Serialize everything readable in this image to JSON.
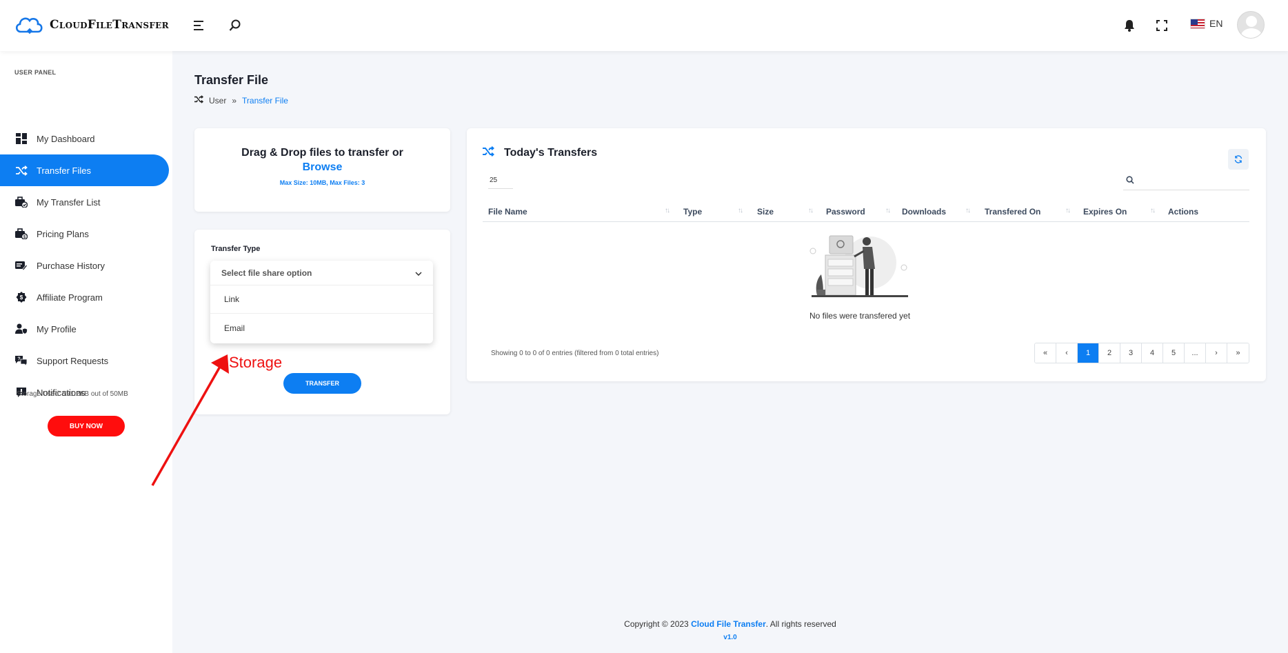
{
  "app": {
    "logo_text": "CloudFileTransfer"
  },
  "header": {
    "language": "EN"
  },
  "sidebar": {
    "panel_label": "USER PANEL",
    "items": [
      {
        "label": "My Dashboard",
        "icon": "dashboard-icon"
      },
      {
        "label": "Transfer Files",
        "icon": "shuffle-icon",
        "active": true
      },
      {
        "label": "My Transfer List",
        "icon": "briefcase-check-icon"
      },
      {
        "label": "Pricing Plans",
        "icon": "briefcase-tag-icon"
      },
      {
        "label": "Purchase History",
        "icon": "edit-card-icon"
      },
      {
        "label": "Affiliate Program",
        "icon": "dollar-badge-icon"
      },
      {
        "label": "My Profile",
        "icon": "user-shield-icon"
      },
      {
        "label": "Support Requests",
        "icon": "question-chat-icon"
      },
      {
        "label": "Notifications",
        "icon": "alert-badge-icon"
      }
    ],
    "storage_used": "Storage Used: 591.2KB out of 50MB",
    "buy_now": "BUY NOW"
  },
  "page": {
    "title": "Transfer File",
    "breadcrumb": {
      "parent": "User",
      "separator": "»",
      "current": "Transfer File"
    }
  },
  "dropzone": {
    "title": "Drag & Drop files to transfer or",
    "browse": "Browse",
    "limits": "Max Size: 10MB, Max Files: 3"
  },
  "transfer_type": {
    "label": "Transfer Type",
    "placeholder": "Select file share option",
    "options": [
      "Link",
      "Email"
    ],
    "button": "TRANSFER"
  },
  "transfers": {
    "title": "Today's Transfers",
    "page_length": "25",
    "columns": [
      "File Name",
      "Type",
      "Size",
      "Password",
      "Downloads",
      "Transfered On",
      "Expires On",
      "Actions"
    ],
    "empty_message": "No files were transfered yet",
    "info": "Showing 0 to 0 of 0 entries (filtered from 0 total entries)",
    "pagination": [
      "«",
      "‹",
      "1",
      "2",
      "3",
      "4",
      "5",
      "...",
      "›",
      "»"
    ],
    "active_page": "1"
  },
  "footer": {
    "prefix": "Copyright © 2023 ",
    "brand": "Cloud File Transfer",
    "suffix": ". All rights reserved",
    "version": "v1.0"
  },
  "annotation": {
    "text": "Storage",
    "color": "#ee1111"
  },
  "colors": {
    "accent": "#0d7ef2",
    "buy": "#ff0d0d"
  }
}
